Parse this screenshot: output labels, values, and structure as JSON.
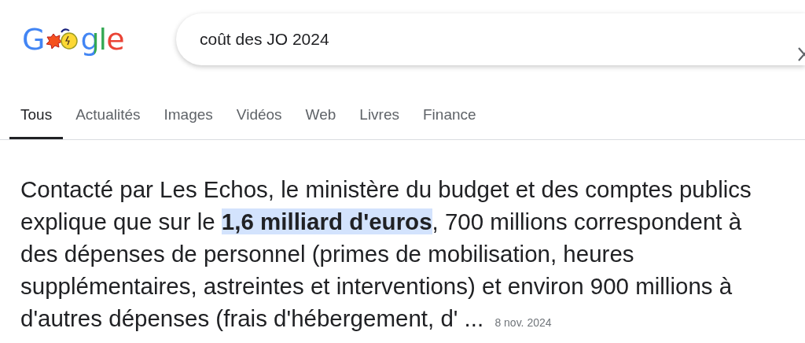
{
  "logo": {
    "lead": "G",
    "tail": "gle"
  },
  "search": {
    "value": "coût des JO 2024"
  },
  "tabs": [
    {
      "label": "Tous",
      "selected": true
    },
    {
      "label": "Actualités",
      "selected": false
    },
    {
      "label": "Images",
      "selected": false
    },
    {
      "label": "Vidéos",
      "selected": false
    },
    {
      "label": "Web",
      "selected": false
    },
    {
      "label": "Livres",
      "selected": false
    },
    {
      "label": "Finance",
      "selected": false
    }
  ],
  "snippet": {
    "text": "Contacté par Les Echos, le ministère du budget et des comptes publics explique que sur le **1,6 milliard d'euros**, 700 millions correspondent à des dépenses de personnel (primes de mobilisation, heures supplémentaires, astreintes et interventions) et environ 900 millions à d'autres dépenses (frais d'hébergement, d' ...",
    "date": "8 nov. 2024"
  }
}
